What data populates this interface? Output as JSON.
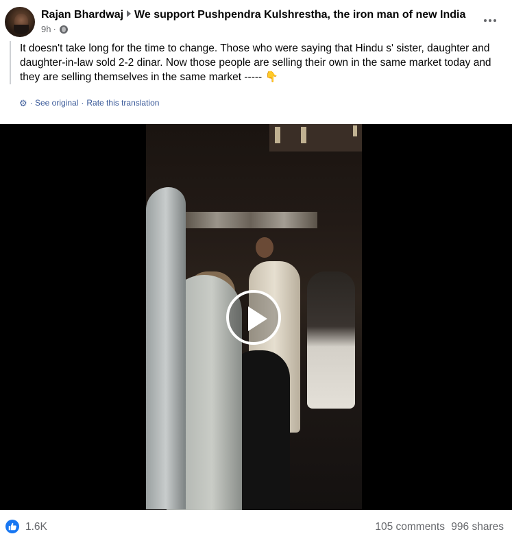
{
  "post": {
    "author": "Rajan Bhardwaj",
    "group": "We support Pushpendra Kulshrestha, the iron man of new India",
    "time": "9h",
    "dot": "·",
    "text": "It doesn't take long for the time to change. Those who were saying that Hindu s' sister, daughter and daughter-in-law sold 2-2 dinar. Now those people are selling their own in the same market today and they are selling themselves in the same market ----- 👇",
    "translation": {
      "see_original": "· See original",
      "separator": "·",
      "rate": "Rate this translation"
    },
    "icons": {
      "privacy": "globe-icon",
      "options": "more-options-icon",
      "translate": "gear-icon",
      "video": "play-icon",
      "reaction": "like-icon"
    }
  },
  "footer": {
    "reactions": "1.6K",
    "comments": "105 comments",
    "shares": "996 shares"
  },
  "colors": {
    "link": "#385898",
    "like": "#1877f2",
    "secondary_text": "#65676b"
  }
}
